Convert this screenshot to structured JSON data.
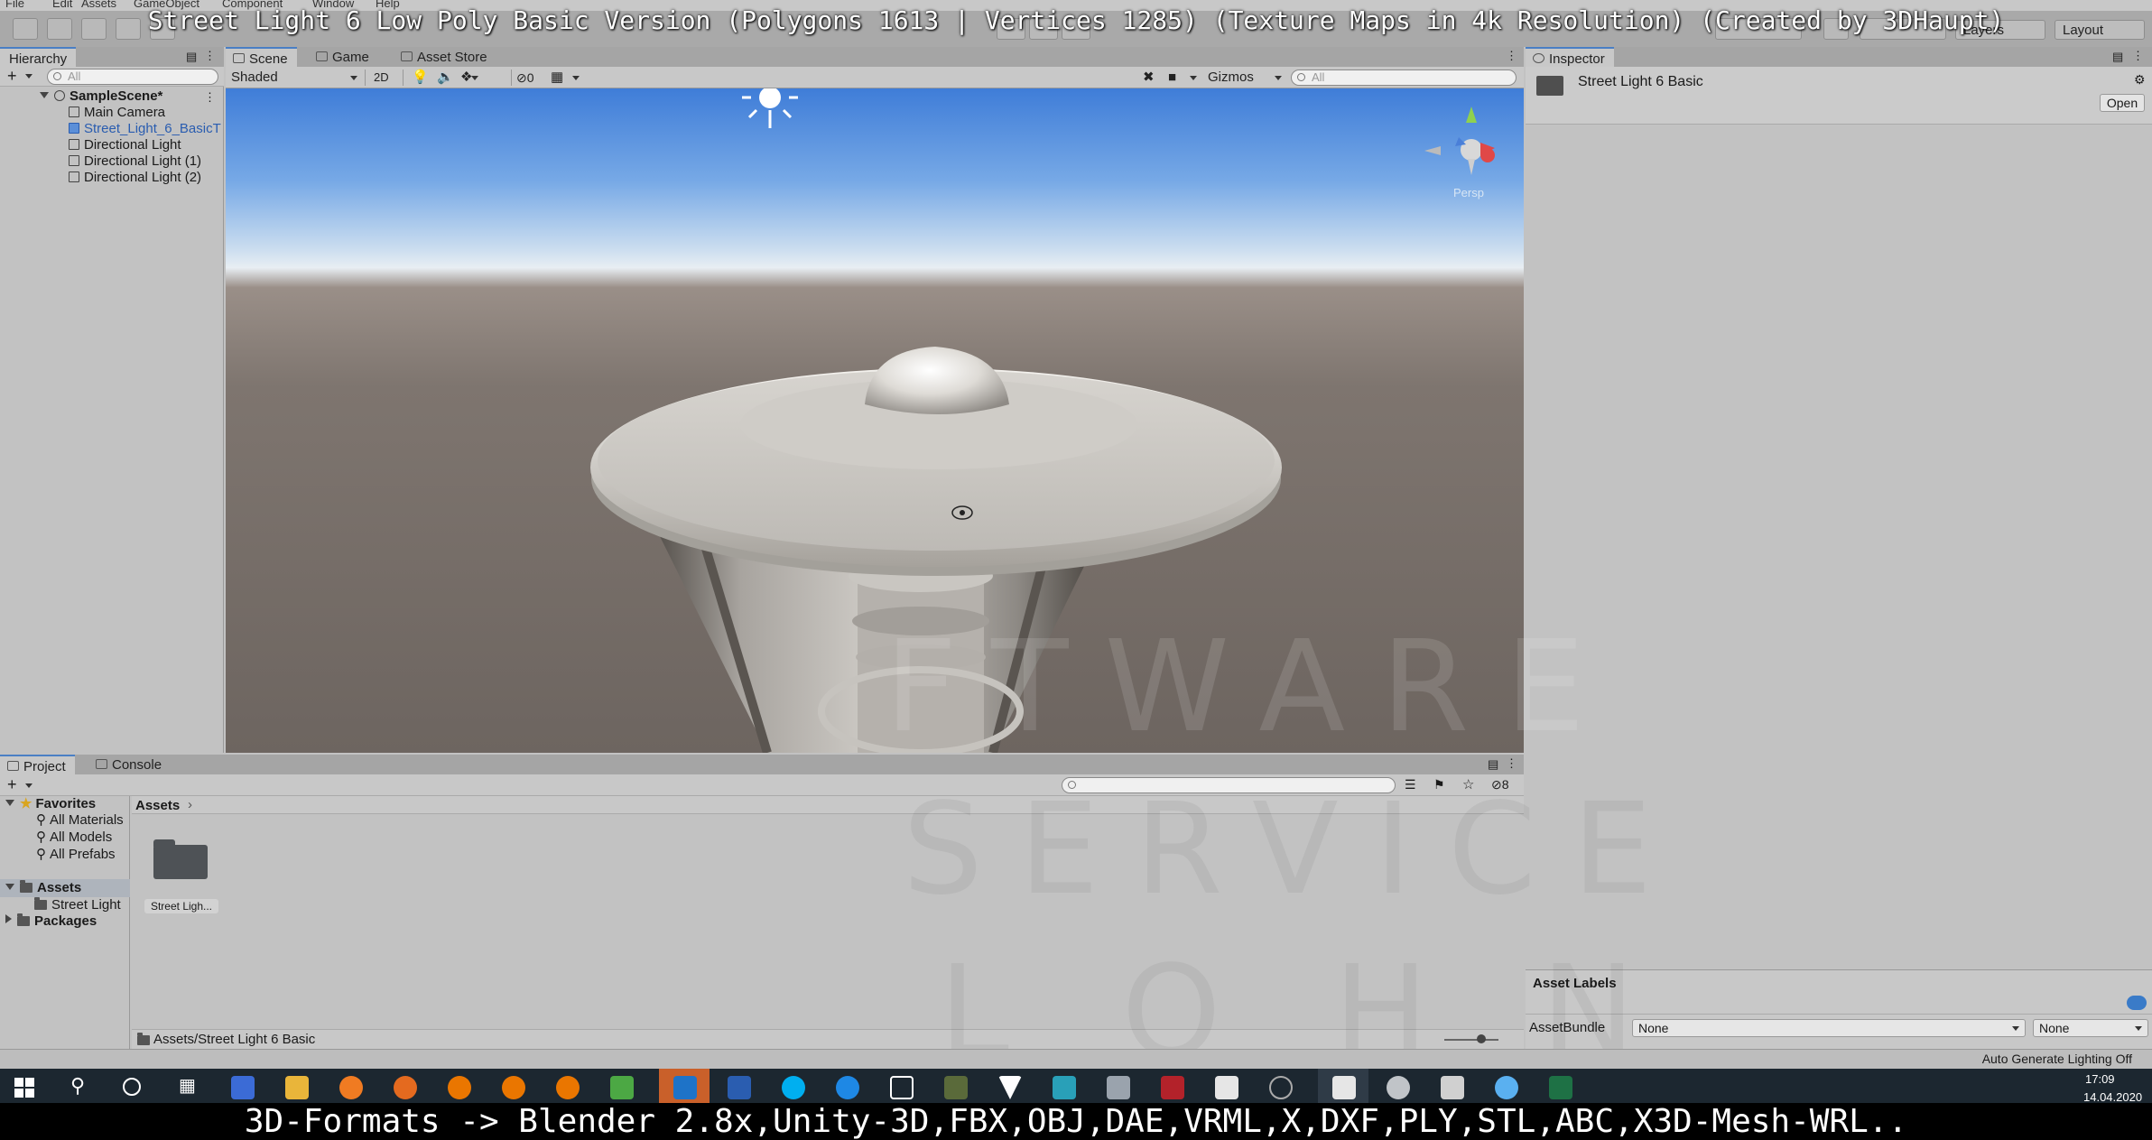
{
  "overlay": {
    "title": "Street Light 6 Low Poly Basic Version (Polygons 1613 | Vertices 1285) (Texture Maps in 4k Resolution) (Created by 3DHaupt)",
    "bottom_caption": "3D-Formats -> Blender 2.8x,Unity-3D,FBX,OBJ,DAE,VRML,X,DXF,PLY,STL,ABC,X3D-Mesh-WRL..",
    "watermark_lines": [
      "FTWARE",
      "SERVICE",
      "L O H N"
    ]
  },
  "menu": {
    "items": [
      "File",
      "Edit",
      "Assets",
      "GameObject",
      "Component",
      "Window",
      "Help"
    ]
  },
  "toolbar": {
    "layers_label": "Layers",
    "layout_label": "Layout"
  },
  "hierarchy": {
    "tab_label": "Hierarchy",
    "add_label": "+",
    "search_placeholder": "All",
    "scene_name": "SampleScene*",
    "items": [
      {
        "label": "Main Camera",
        "selected": false
      },
      {
        "label": "Street_Light_6_BasicT",
        "selected": true
      },
      {
        "label": "Directional Light",
        "selected": false
      },
      {
        "label": "Directional Light (1)",
        "selected": false
      },
      {
        "label": "Directional Light (2)",
        "selected": false
      }
    ]
  },
  "scene_tabs": {
    "tabs": [
      "Scene",
      "Game",
      "Asset Store"
    ],
    "active": "Scene"
  },
  "scene_toolbar": {
    "shading_mode": "Shaded",
    "mode_2d": "2D",
    "hidden_count": "0",
    "gizmos_label": "Gizmos",
    "search_placeholder": "All"
  },
  "scene_view": {
    "persp_label": "Persp"
  },
  "inspector": {
    "tab_label": "Inspector",
    "asset_name": "Street Light 6 Basic",
    "open_button": "Open",
    "asset_labels_title": "Asset Labels",
    "asset_bundle_label": "AssetBundle",
    "asset_bundle_value": "None",
    "asset_bundle_variant": "None"
  },
  "project": {
    "tabs": [
      "Project",
      "Console"
    ],
    "active": "Project",
    "add_label": "+",
    "hidden_count": "8",
    "favorites_label": "Favorites",
    "favorites": [
      "All Materials",
      "All Models",
      "All Prefabs"
    ],
    "assets_label": "Assets",
    "assets_children": [
      "Street Light"
    ],
    "packages_label": "Packages",
    "breadcrumb": "Assets",
    "grid_items": [
      {
        "label": "Street Ligh..."
      }
    ],
    "path": "Assets/Street Light 6 Basic"
  },
  "status": {
    "lighting": "Auto Generate Lighting Off"
  },
  "taskbar": {
    "time": "17:09",
    "date": "14.04.2020"
  },
  "colors": {
    "selection_blue": "#2a5db0",
    "tab_accent": "#4a7fc4",
    "taskbar_bg": "#1c2730"
  }
}
